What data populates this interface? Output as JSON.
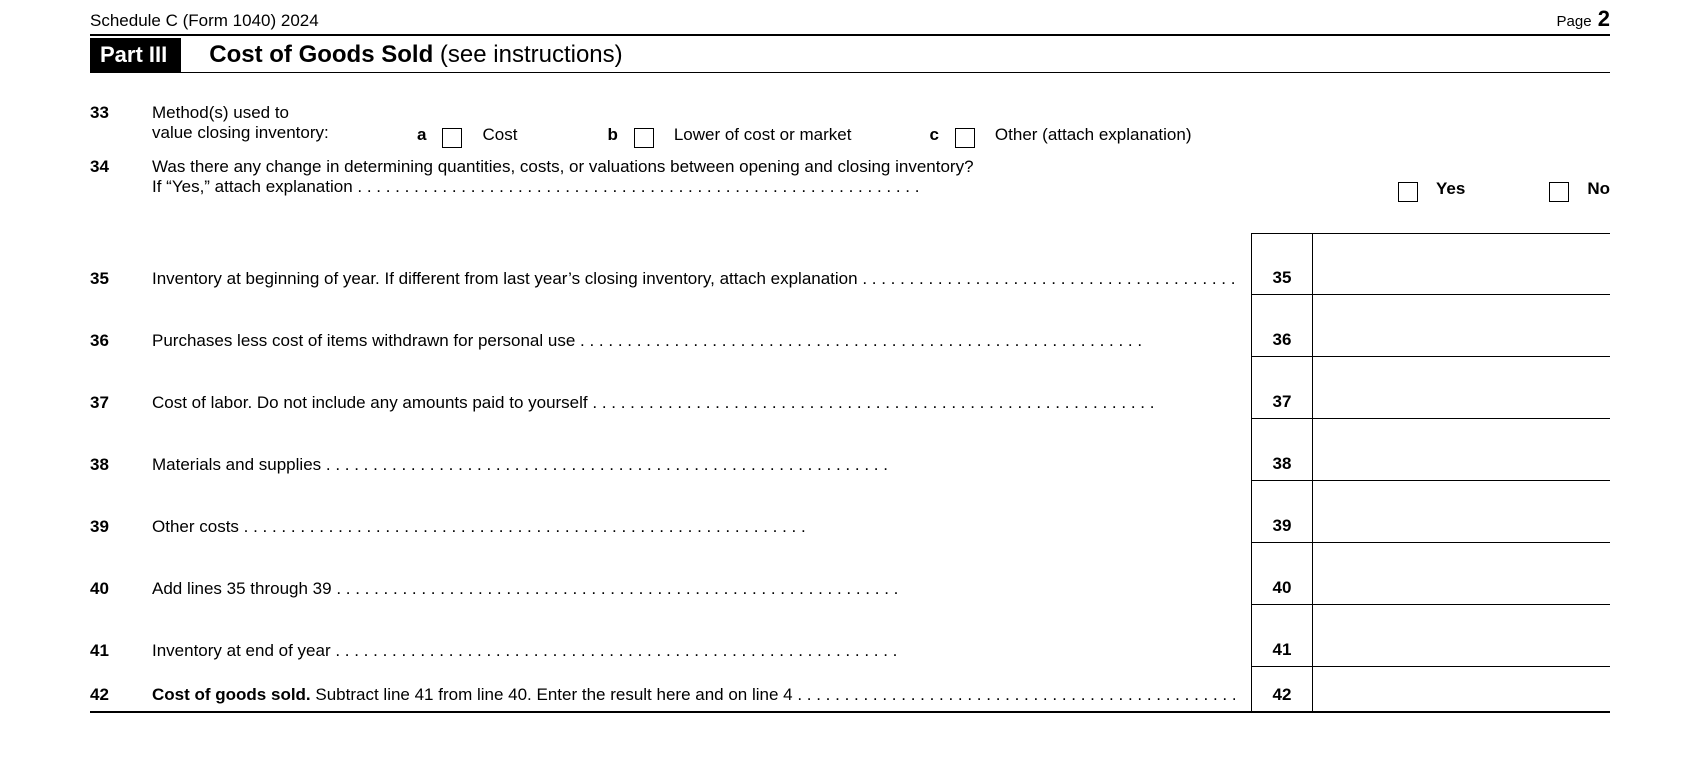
{
  "header": {
    "form_left": "Schedule C (Form 1040) 2024",
    "page_word": "Page",
    "page_num": "2"
  },
  "part": {
    "badge": "Part III",
    "title_bold": "Cost of Goods Sold",
    "title_rest": " (see instructions)"
  },
  "line33": {
    "num": "33",
    "desc_l1": "Method(s) used to",
    "desc_l2": "value closing inventory:",
    "a": "a",
    "a_label": "Cost",
    "b": "b",
    "b_label": "Lower of cost or market",
    "c": "c",
    "c_label": "Other (attach explanation)"
  },
  "line34": {
    "num": "34",
    "text_l1": "Was there any change in determining quantities, costs, or valuations between opening and closing inventory?",
    "text_l2": "If “Yes,” attach explanation",
    "yes": "Yes",
    "no": "No"
  },
  "rows": {
    "35": {
      "num": "35",
      "label": "Inventory at beginning of year. If different from last year’s closing inventory, attach explanation",
      "box": "35"
    },
    "36": {
      "num": "36",
      "label": "Purchases less cost of items withdrawn for personal use",
      "box": "36"
    },
    "37": {
      "num": "37",
      "label": "Cost of labor. Do not include any amounts paid to yourself",
      "box": "37"
    },
    "38": {
      "num": "38",
      "label": "Materials and supplies",
      "box": "38"
    },
    "39": {
      "num": "39",
      "label": "Other costs",
      "box": "39"
    },
    "40": {
      "num": "40",
      "label": "Add lines 35 through 39",
      "box": "40"
    },
    "41": {
      "num": "41",
      "label": "Inventory at end of year",
      "box": "41"
    },
    "42": {
      "num": "42",
      "bold": "Cost of goods sold.",
      "label": " Subtract line 41 from line 40. Enter the result here and on line 4",
      "box": "42"
    }
  }
}
